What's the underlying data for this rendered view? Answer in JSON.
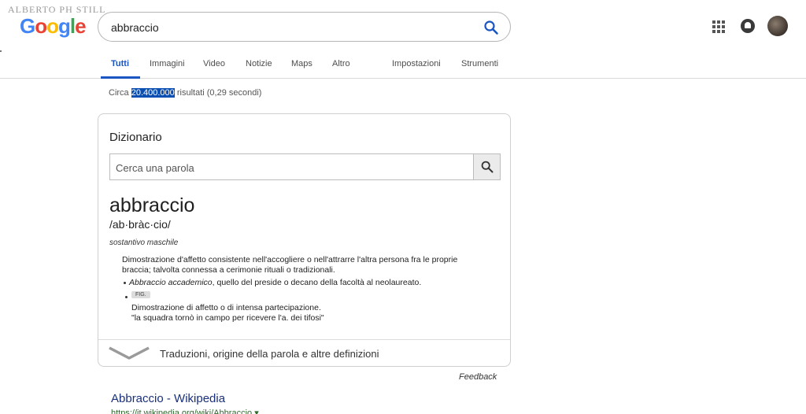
{
  "watermark": "ALBERTO PH STILL",
  "logo": {
    "letters": [
      "G",
      "o",
      "o",
      "g",
      "l",
      "e"
    ]
  },
  "search": {
    "query": "abbraccio",
    "icon": "search-icon"
  },
  "header_icons": {
    "apps": "apps-grid-icon",
    "notifications": "bell-icon",
    "account": "avatar"
  },
  "tabs": [
    {
      "label": "Tutti",
      "active": true
    },
    {
      "label": "Immagini"
    },
    {
      "label": "Video"
    },
    {
      "label": "Notizie"
    },
    {
      "label": "Maps"
    },
    {
      "label": "Altro"
    },
    {
      "label": "Impostazioni"
    },
    {
      "label": "Strumenti"
    }
  ],
  "stats": {
    "prefix": "Circa",
    "count": "20.400.000",
    "suffix": "risultati (0,29 secondi)"
  },
  "dictionary": {
    "title": "Dizionario",
    "search_placeholder": "Cerca una parola",
    "word": "abbraccio",
    "phonetic": "/ab·bràc·cio/",
    "part_of_speech": "sostantivo maschile",
    "definition": "Dimostrazione d'affetto consistente nell'accogliere o nell'attrarre l'altra persona fra le proprie braccia; talvolta connessa a cerimonie rituali o tradizionali.",
    "example_term": "Abbraccio accademico",
    "example_rest": ", quello del preside o decano della facoltà al neolaureato.",
    "fig_badge": "FIG.",
    "fig_definition": "Dimostrazione di affetto o di intensa partecipazione.",
    "fig_example": "\"la squadra tornò in campo per ricevere l'a. dei tifosi\"",
    "more_link": "Traduzioni, origine della parola e altre definizioni"
  },
  "feedback": "Feedback",
  "result": {
    "title": "Abbraccio - Wikipedia",
    "url": "https://it.wikipedia.org/wiki/Abbraccio ▾"
  },
  "colors": {
    "accent": "#1a55c2",
    "highlight": "#0b4fb3",
    "result_title": "#1a2f7a"
  }
}
